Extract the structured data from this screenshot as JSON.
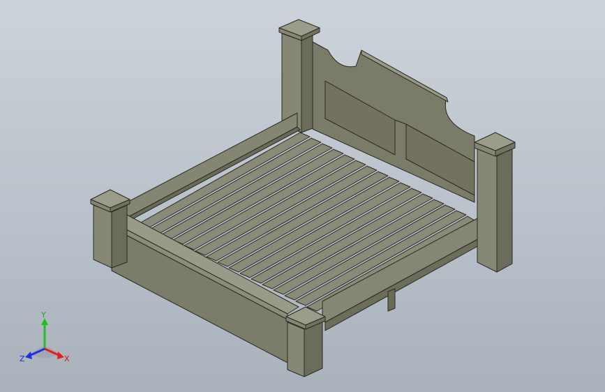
{
  "viewport": {
    "background_top": "#cdd3da",
    "background_bottom": "#a9b1bb"
  },
  "model": {
    "wood_color": "#787867",
    "edge_color": "#2a2a22"
  },
  "triad": {
    "x_label": "X",
    "y_label": "Y",
    "z_label": "Z",
    "x_color": "#e02020",
    "y_color": "#20c020",
    "z_color": "#2030e0"
  }
}
